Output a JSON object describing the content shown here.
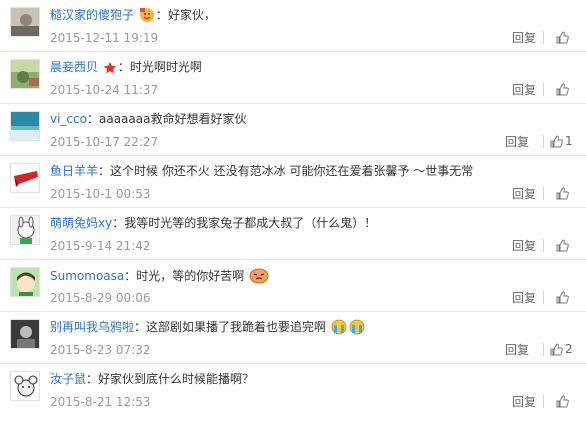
{
  "reply_label": "回复",
  "separator": "：",
  "comments": [
    {
      "user": "糙汉家的傻狍子",
      "text": "好家伙，",
      "time": "2015-12-11 19:19",
      "likes": "",
      "user_badge": "vip-emoji-icon"
    },
    {
      "user": "晨妾西贝",
      "text": "时光啊时光啊",
      "time": "2015-10-24 11:37",
      "likes": "",
      "user_badge": "star-icon"
    },
    {
      "user": "vi_cco",
      "text": "aaaaaaa救命好想看好家伙",
      "time": "2015-10-17 22:27",
      "likes": "1"
    },
    {
      "user": "鱼日羊羊",
      "text": "这个时候 你还不火 还没有范冰冰 可能你还在爱着张馨予 ～世事无常",
      "time": "2015-10-1 00:53",
      "likes": ""
    },
    {
      "user": "萌萌兔妈xy",
      "text": "我等时光等的我家兔子都成大叔了（什么鬼）！",
      "time": "2015-9-14 21:42",
      "likes": ""
    },
    {
      "user": "Sumomoasa",
      "text": "时光，等的你好苦啊",
      "time": "2015-8-29 00:06",
      "likes": "",
      "trailing_emoji": "cry-face-emoji"
    },
    {
      "user": "别再叫我乌鸦啦",
      "text": "这部剧如果播了我跪着也要追完啊",
      "time": "2015-8-23 07:32",
      "likes": "2",
      "trailing_emoji": "tears-face-emoji"
    },
    {
      "user": "汝子鼠",
      "text": "好家伙到底什么时候能播啊？",
      "time": "2015-8-21 12:53",
      "likes": ""
    }
  ],
  "colors": {
    "username": "#2d73c4",
    "timestamp": "#999999",
    "text": "#333333"
  }
}
